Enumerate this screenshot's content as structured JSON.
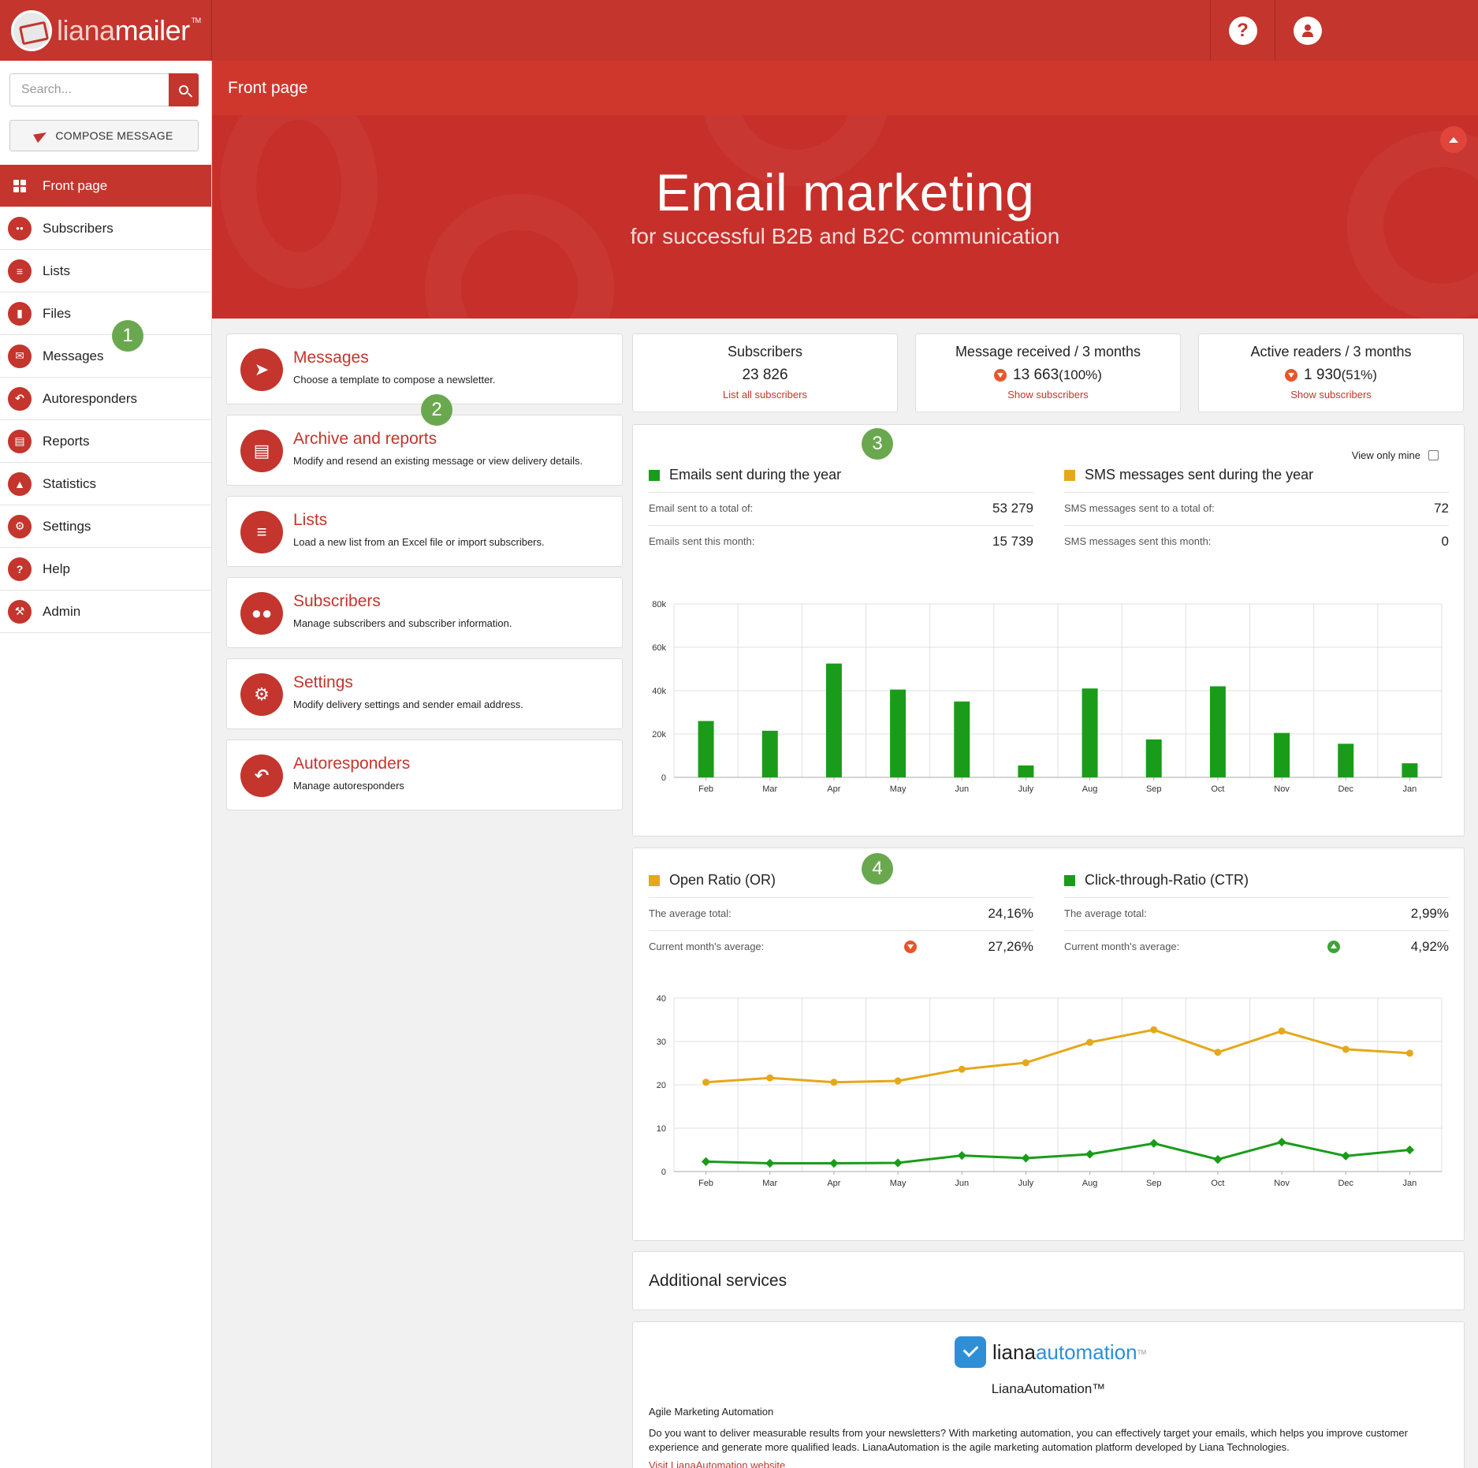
{
  "app": {
    "logo_prefix": "liana",
    "logo_suffix": "mailer",
    "logo_tm": "TM",
    "help_icon": "?"
  },
  "search": {
    "placeholder": "Search..."
  },
  "compose_label": "COMPOSE MESSAGE",
  "nav": [
    {
      "label": "Front page",
      "icon": "grid-icon",
      "active": true
    },
    {
      "label": "Subscribers",
      "icon": "users-icon"
    },
    {
      "label": "Lists",
      "icon": "list-icon"
    },
    {
      "label": "Files",
      "icon": "folder-icon"
    },
    {
      "label": "Messages",
      "icon": "envelope-icon"
    },
    {
      "label": "Autoresponders",
      "icon": "reply-icon"
    },
    {
      "label": "Reports",
      "icon": "document-icon"
    },
    {
      "label": "Statistics",
      "icon": "area-chart-icon"
    },
    {
      "label": "Settings",
      "icon": "gears-icon"
    },
    {
      "label": "Help",
      "icon": "question-icon"
    },
    {
      "label": "Admin",
      "icon": "wrench-icon"
    }
  ],
  "page_title": "Front page",
  "hero": {
    "title": "Email marketing",
    "subtitle": "for successful B2B and B2C communication"
  },
  "badges": [
    "1",
    "2",
    "3",
    "4"
  ],
  "cards": [
    {
      "title": "Messages",
      "desc": "Choose a template to compose a newsletter.",
      "icon": "paper-plane-icon"
    },
    {
      "title": "Archive and reports",
      "desc": "Modify and resend an existing message or view delivery details.",
      "icon": "document-icon"
    },
    {
      "title": "Lists",
      "desc": "Load a new list from an Excel file or import subscribers.",
      "icon": "list-icon"
    },
    {
      "title": "Subscribers",
      "desc": "Manage subscribers and subscriber information.",
      "icon": "users-icon"
    },
    {
      "title": "Settings",
      "desc": "Modify delivery settings and sender email address.",
      "icon": "gears-icon"
    },
    {
      "title": "Autoresponders",
      "desc": "Manage autoresponders",
      "icon": "reply-icon"
    }
  ],
  "stats": [
    {
      "title": "Subscribers",
      "value": "23 826",
      "pct": "",
      "link": "List all subscribers",
      "trend": ""
    },
    {
      "title": "Message received / 3 months",
      "value": "13 663",
      "pct": "(100%)",
      "link": "Show subscribers",
      "trend": "down"
    },
    {
      "title": "Active readers / 3 months",
      "value": "1 930",
      "pct": "(51%)",
      "link": "Show subscribers",
      "trend": "down"
    }
  ],
  "sent_panel": {
    "view_only_mine": "View only mine",
    "emails": {
      "title": "Emails sent during the year",
      "color": "#1a9c1a",
      "total_label": "Email sent to a total of:",
      "total": "53 279",
      "month_label": "Emails sent this month:",
      "month": "15 739"
    },
    "sms": {
      "title": "SMS messages sent during the year",
      "color": "#e5a81a",
      "total_label": "SMS messages sent to a total of:",
      "total": "72",
      "month_label": "SMS messages sent this month:",
      "month": "0"
    }
  },
  "ratio_panel": {
    "or": {
      "title": "Open Ratio (OR)",
      "color": "#e5a81a",
      "avg_label": "The average total:",
      "avg": "24,16%",
      "month_label": "Current month's average:",
      "month": "27,26%",
      "trend": "down"
    },
    "ctr": {
      "title": "Click-through-Ratio (CTR)",
      "color": "#1a9c1a",
      "avg_label": "The average total:",
      "avg": "2,99%",
      "month_label": "Current month's average:",
      "month": "4,92%",
      "trend": "up"
    }
  },
  "chart_data": [
    {
      "type": "bar",
      "categories": [
        "Feb",
        "Mar",
        "Apr",
        "May",
        "Jun",
        "July",
        "Aug",
        "Sep",
        "Oct",
        "Nov",
        "Dec",
        "Jan"
      ],
      "series": [
        {
          "name": "Emails sent during the year",
          "values": [
            26000,
            21500,
            52500,
            40500,
            35000,
            5500,
            41000,
            17500,
            42000,
            20500,
            15500,
            6500
          ]
        }
      ],
      "y_ticks": [
        "0",
        "20k",
        "40k",
        "60k",
        "80k"
      ],
      "ylim": [
        0,
        80000
      ],
      "grid": true
    },
    {
      "type": "line",
      "categories": [
        "Feb",
        "Mar",
        "Apr",
        "May",
        "Jun",
        "July",
        "Aug",
        "Sep",
        "Oct",
        "Nov",
        "Dec",
        "Jan"
      ],
      "series": [
        {
          "name": "Open Ratio (OR)",
          "values": [
            20.6,
            21.6,
            20.6,
            20.9,
            23.6,
            25.1,
            29.8,
            32.7,
            27.5,
            32.4,
            28.2,
            27.3
          ]
        },
        {
          "name": "Click-through-Ratio (CTR)",
          "values": [
            2.3,
            1.9,
            1.9,
            2.0,
            3.7,
            3.1,
            4.0,
            6.5,
            2.8,
            6.8,
            3.6,
            5.0
          ]
        }
      ],
      "y_ticks": [
        "0",
        "10",
        "20",
        "30",
        "40"
      ],
      "ylim": [
        0,
        40
      ],
      "grid": true
    }
  ],
  "additional": {
    "title": "Additional services",
    "logo_prefix": "liana",
    "logo_suffix": "automation",
    "logo_tm": "TM",
    "name": "LianaAutomation™",
    "tagline": "Agile Marketing Automation",
    "desc": "Do you want to deliver measurable results from your newsletters? With marketing automation, you can effectively target your emails, which helps you improve customer experience and generate more qualified leads. LianaAutomation is the agile marketing automation platform developed by Liana Technologies.",
    "link": "Visit LianaAutomation website"
  }
}
